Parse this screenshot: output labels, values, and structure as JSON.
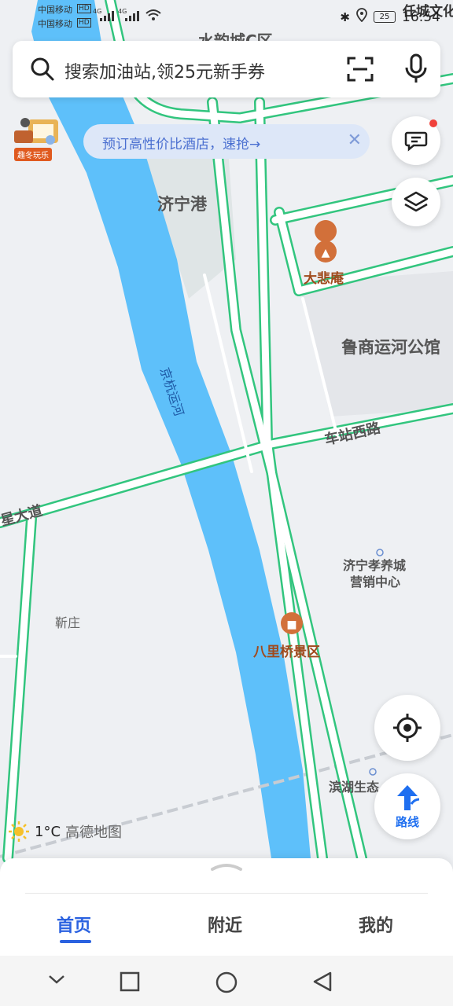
{
  "status_bar": {
    "carrier1": "中国移动",
    "carrier2": "中国移动",
    "hd": "HD",
    "network": "4G",
    "battery": "25",
    "time": "16:54"
  },
  "search": {
    "placeholder": "搜索加油站,领25元新手券"
  },
  "promo": {
    "text": "预订高性价比酒店，速抢→",
    "badge": "趣冬玩乐"
  },
  "map_labels": {
    "shuiyun": "水韵城C区",
    "rencheng": "任城文化",
    "jininggang": "济宁港",
    "dabeian": "大悲庵",
    "lushang": "鲁商运河公馆",
    "canal": "京杭运河",
    "chezhan": "车站西路",
    "xingxing": "星大道",
    "xiaoyang": "济宁孝养城",
    "xiaoyang2": "营销中心",
    "jinzhuang": "靳庄",
    "balqiao": "八里桥景区",
    "binhu": "滨湖生态"
  },
  "weather": {
    "temp": "1°C",
    "brand": "高德地图"
  },
  "route_button": {
    "label": "路线"
  },
  "tabs": [
    {
      "label": "首页",
      "active": true
    },
    {
      "label": "附近",
      "active": false
    },
    {
      "label": "我的",
      "active": false
    }
  ],
  "colors": {
    "accent": "#2b62e0",
    "river": "#5ec0fa",
    "road": "#32c57e",
    "poi": "#c0622f"
  }
}
